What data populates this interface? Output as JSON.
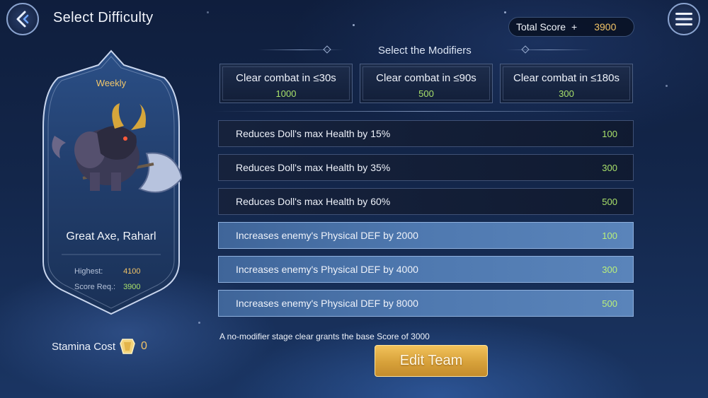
{
  "header": {
    "title": "Select Difficulty"
  },
  "score": {
    "label": "Total Score",
    "plus": "+",
    "value": "3900"
  },
  "boss": {
    "tag": "Weekly",
    "name": "Great Axe, Raharl",
    "highest_label": "Highest:",
    "highest_value": "4100",
    "score_req_label": "Score Req.:",
    "score_req_value": "3900"
  },
  "stamina": {
    "label": "Stamina Cost",
    "value": "0"
  },
  "modifiers": {
    "title": "Select the Modifiers",
    "combat": [
      {
        "label": "Clear combat in ≤30s",
        "value": "1000"
      },
      {
        "label": "Clear combat in ≤90s",
        "value": "500"
      },
      {
        "label": "Clear combat in ≤180s",
        "value": "300"
      }
    ],
    "list": [
      {
        "label": "Reduces Doll's max Health by 15%",
        "points": "100",
        "selected": false
      },
      {
        "label": "Reduces Doll's max Health by 35%",
        "points": "300",
        "selected": false
      },
      {
        "label": "Reduces Doll's max Health by 60%",
        "points": "500",
        "selected": false
      },
      {
        "label": "Increases enemy's Physical DEF by 2000",
        "points": "100",
        "selected": true
      },
      {
        "label": "Increases enemy's Physical DEF by 4000",
        "points": "300",
        "selected": true
      },
      {
        "label": "Increases enemy's Physical DEF by 8000",
        "points": "500",
        "selected": true
      }
    ],
    "note": "A no-modifier stage clear grants the base Score of 3000"
  },
  "actions": {
    "edit_team": "Edit Team"
  },
  "icons": {
    "back": "back-arrow-icon",
    "menu": "hamburger-menu-icon",
    "stamina": "stamina-gem-icon"
  },
  "colors": {
    "accent_gold": "#f2c467",
    "points_green": "#a8e06a",
    "selected_row": "#4f79b0",
    "button_gold": "#d7a13a"
  }
}
